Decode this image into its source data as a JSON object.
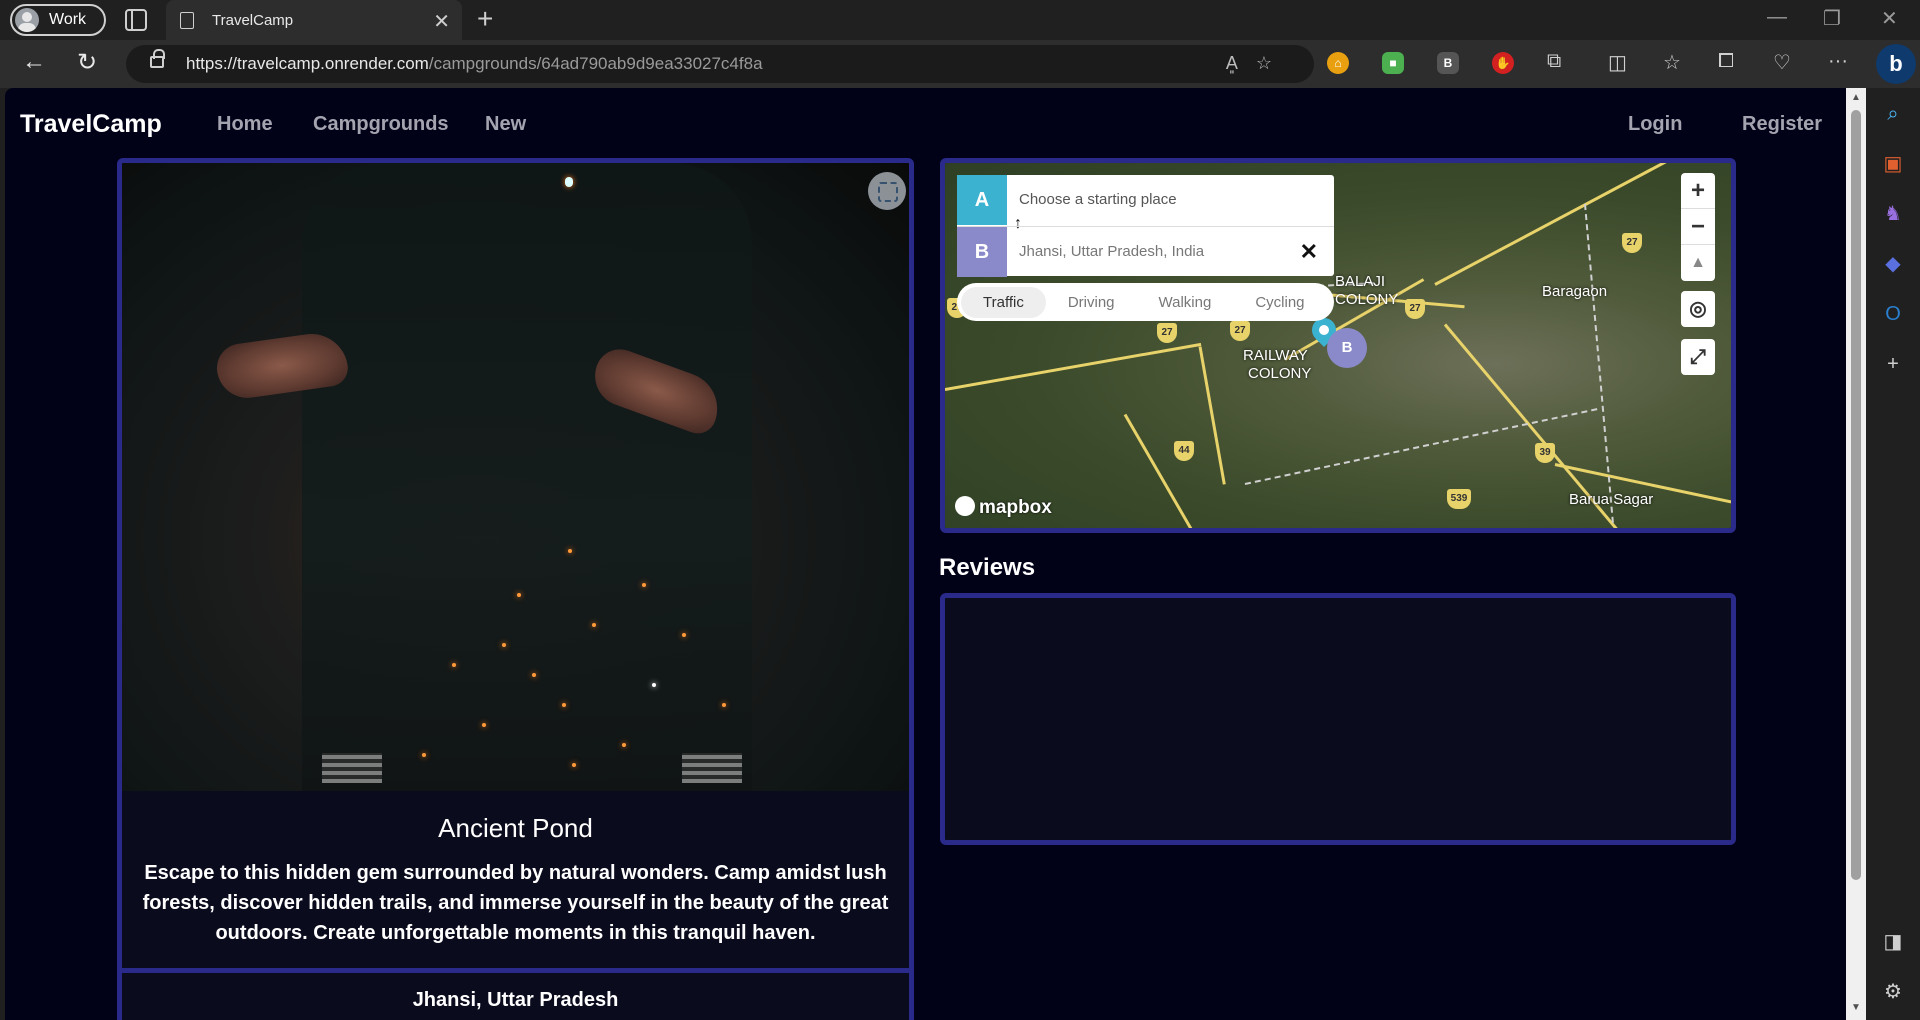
{
  "browser": {
    "profile_label": "Work",
    "tab_title": "TravelCamp",
    "url_host": "https://travelcamp.onrender.com",
    "url_path": "/campgrounds/64ad790ab9d9ea33027c4f8a"
  },
  "navbar": {
    "brand": "TravelCamp",
    "links": [
      "Home",
      "Campgrounds",
      "New"
    ],
    "login": "Login",
    "register": "Register"
  },
  "campground": {
    "title": "Ancient Pond",
    "description": "Escape to this hidden gem surrounded by natural wonders. Camp amidst lush forests, discover hidden trails, and immerse yourself in the beauty of the great outdoors. Create unforgettable moments in this tranquil haven.",
    "location": "Jhansi, Uttar Pradesh"
  },
  "map": {
    "origin_badge": "A",
    "destination_badge": "B",
    "origin_placeholder": "Choose a starting place",
    "destination_value": "Jhansi, Uttar Pradesh, India",
    "profiles": [
      "Traffic",
      "Driving",
      "Walking",
      "Cycling"
    ],
    "active_profile": "Traffic",
    "labels": {
      "railway_colony_1": "RAILWAY",
      "railway_colony_2": "COLONY",
      "balaji_1": "BALAJI",
      "balaji_2": "COLONY",
      "baragaon": "Baragaon",
      "barua_sagar": "Barua Sagar"
    },
    "shields": [
      "27",
      "27",
      "27",
      "27",
      "44",
      "39",
      "539",
      "27"
    ],
    "attribution": "mapbox"
  },
  "reviews": {
    "title": "Reviews"
  },
  "colors": {
    "page_bg": "#010118",
    "card_border": "#2a2a8a",
    "origin_badge": "#3bb2d0",
    "destination_badge": "#8a8acb"
  }
}
